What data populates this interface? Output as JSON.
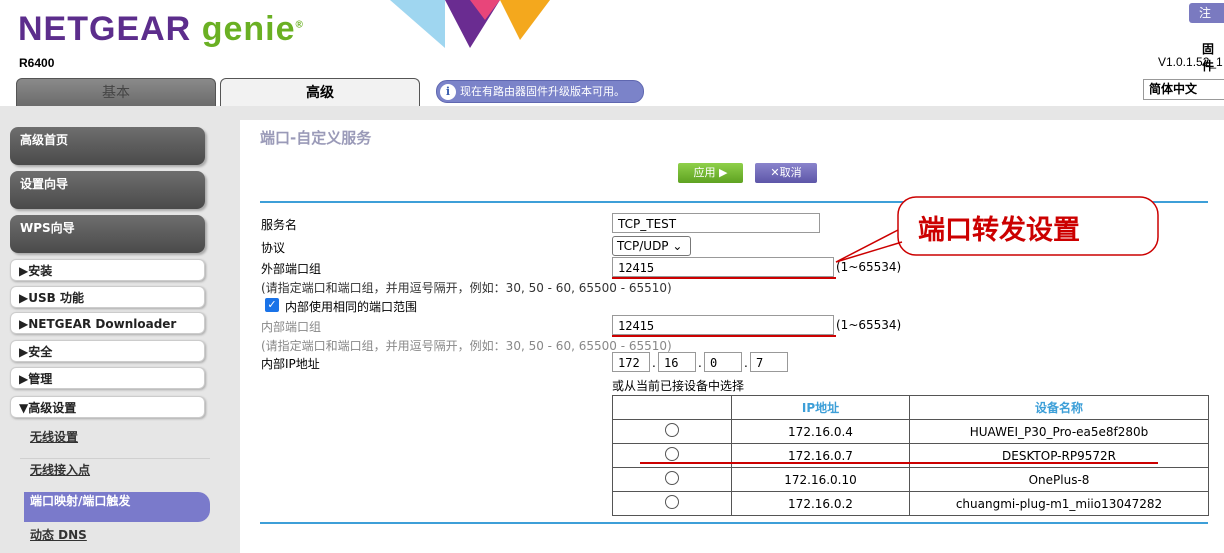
{
  "header": {
    "logo_text": "NETGEAR",
    "logo_genie": "genie",
    "logo_mark": "®",
    "model": "R6400",
    "tabs": [
      "基本",
      "高级"
    ],
    "notice": "现在有路由器固件升级版本可用。",
    "logout_partial": "注",
    "firmware_label": "固件",
    "firmware_version": "V1.0.1.52_1",
    "language": "简体中文",
    "icons": {
      "notice": "info-icon"
    }
  },
  "sidebar": {
    "big_buttons": [
      "高级首页",
      "设置向导",
      "WPS向导"
    ],
    "menus": [
      "▶安装",
      "▶USB 功能",
      "▶NETGEAR Downloader",
      "▶安全",
      "▶管理",
      "▼高级设置"
    ],
    "subitems": [
      "无线设置",
      "无线接入点",
      "端口映射/端口触发",
      "动态 DNS"
    ]
  },
  "main": {
    "title": "端口-自定义服务",
    "apply_label": "应用 ▶",
    "cancel_label": "✕取消",
    "form": {
      "service_name_label": "服务名",
      "service_name_value": "TCP_TEST",
      "protocol_label": "协议",
      "protocol_value": "TCP/UDP",
      "ext_port_label": "外部端口组",
      "ext_port_value": "12415",
      "ext_port_range": "(1~65534)",
      "ext_hint": "(请指定端口和端口组，并用逗号隔开，例如：30, 50 - 60, 65500 - 65510)",
      "same_range_label": "内部使用相同的端口范围",
      "same_range_checked": true,
      "int_port_label": "内部端口组",
      "int_port_value": "12415",
      "int_port_range": "(1~65534)",
      "int_hint": "(请指定端口和端口组，并用逗号隔开，例如：30, 50 - 60, 65500 - 65510)",
      "ip_label": "内部IP地址",
      "ip_octets": [
        "172",
        "16",
        "0",
        "7"
      ],
      "choose_label": "或从当前已接设备中选择"
    },
    "devices_table": {
      "headers": [
        "",
        "IP地址",
        "设备名称"
      ],
      "rows": [
        {
          "ip": "172.16.0.4",
          "name": "HUAWEI_P30_Pro-ea5e8f280b"
        },
        {
          "ip": "172.16.0.7",
          "name": "DESKTOP-RP9572R"
        },
        {
          "ip": "172.16.0.10",
          "name": "OnePlus-8"
        },
        {
          "ip": "172.16.0.2",
          "name": "chuangmi-plug-m1_miio13047282"
        }
      ]
    },
    "annotation": "端口转发设置"
  },
  "colors": {
    "brand_purple": "#5c2d8c",
    "brand_green": "#6ab023",
    "accent_blue": "#3d9fd8",
    "annotation_red": "#cc0000"
  }
}
